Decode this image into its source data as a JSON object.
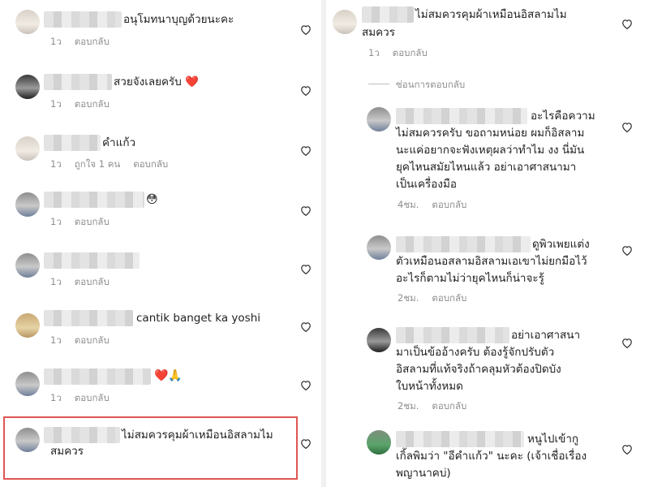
{
  "colors": {
    "text": "#222222",
    "meta": "#8e8e8e",
    "highlight": "#e05555",
    "heart_red": "#e0245e"
  },
  "left_comments": [
    {
      "text": "อนุโมทนาบุญด้วยนะคะ",
      "time": "1ว",
      "reply": "ตอบกลับ"
    },
    {
      "text": "สวยจังเลยครับ ❤️",
      "time": "1ว",
      "reply": "ตอบกลับ"
    },
    {
      "text": "คำแก้ว",
      "time": "1ว",
      "likes": "ถูกใจ 1 คน",
      "reply": "ตอบกลับ"
    },
    {
      "text": "😳",
      "time": "1ว",
      "reply": "ตอบกลับ"
    },
    {
      "text": "",
      "time": "1ว",
      "reply": "ตอบกลับ"
    },
    {
      "text": "cantik banget ka yoshi",
      "time": "1ว",
      "reply": "ตอบกลับ"
    },
    {
      "text": "❤️🙏",
      "time": "1ว",
      "reply": "ตอบกลับ"
    },
    {
      "line1": "ไม่สมควรคุมผ้าเหมือนอิสลามไม",
      "line2": "สมควร"
    }
  ],
  "right_top": {
    "line1": "ไม่สมควรคุมผ้าเหมือนอิสลามไม",
    "line2": "สมควร",
    "time": "1ว",
    "reply": "ตอบกลับ",
    "hide_replies": "ซ่อนการตอบกลับ"
  },
  "right_replies": [
    {
      "lines": [
        "อะไรคือความ",
        "ไม่สมควรครับ ขอถามหน่อย ผมก็อิสลาม",
        "นะแค่อยากจะฟังเหตุผลว่าทำไม งง นี่มัน",
        "ยุคไหนสมัยไหนแล้ว อย่าเอาศาสนามา",
        "เป็นเครื่องมือ"
      ],
      "time": "4ชม.",
      "reply": "ตอบกลับ"
    },
    {
      "lines": [
        "ดูพิวเพยแต่ง",
        "ตัวเหมือนอสลามอิสลามเอเขาไม่ยกมือไว้",
        "อะไรก็ตามไม่ว่ายุคไหนก็น่าจะรู้"
      ],
      "time": "2ชม.",
      "reply": "ตอบกลับ"
    },
    {
      "lines": [
        "อย่าเอาศาสนา",
        "มาเป็นข้ออ้างครับ ต้องรู้จักปรับตัว",
        "อิสลามที่แท้จริงถ้าคลุมหัวต้องปิดบัง",
        "ใบหน้าทั้งหมด"
      ],
      "time": "2ชม.",
      "reply": "ตอบกลับ"
    },
    {
      "lines": [
        "หนูไปเข้ากู",
        "เกิ้ลพิมว่า \"อีคำแก้ว\" นะคะ (เจ้าเชื่อเรื่อง",
        "พญานาคบ่)"
      ]
    }
  ]
}
